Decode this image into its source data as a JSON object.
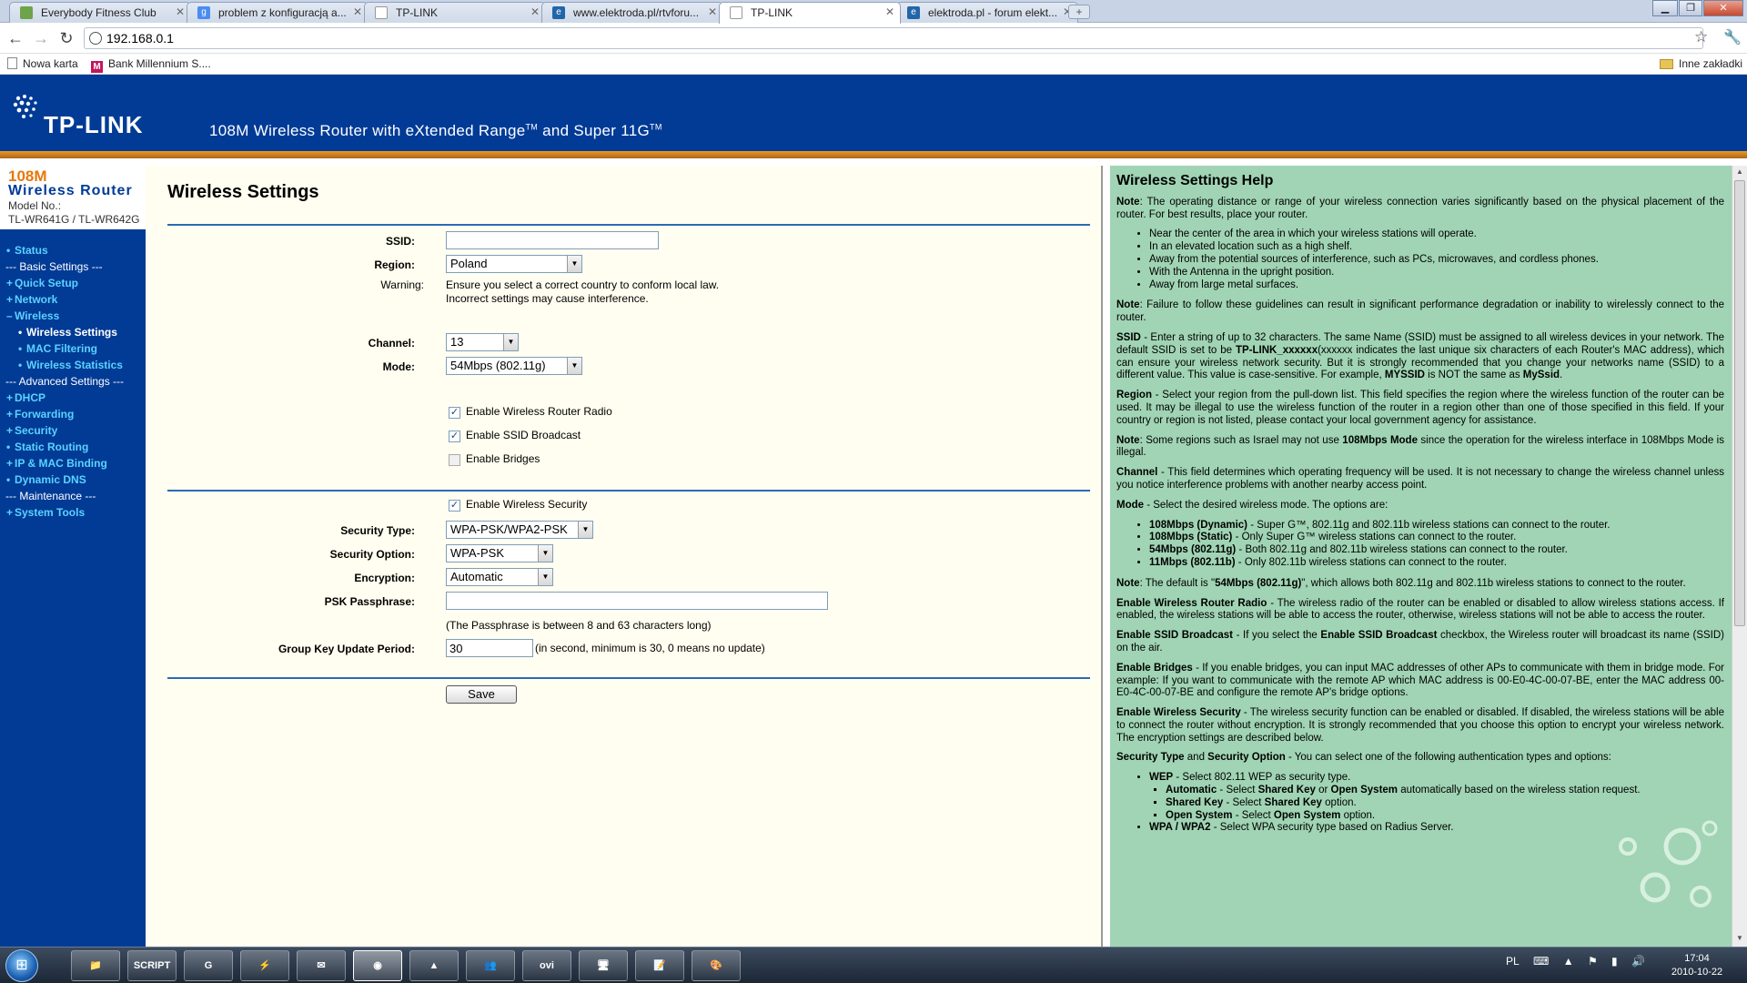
{
  "browser": {
    "tabs": [
      {
        "title": "Everybody Fitness Club",
        "favicon": "page-icon",
        "color": "#e8f0e0"
      },
      {
        "title": "problem z konfiguracją a...",
        "favicon": "google-icon",
        "color": "#4a8cf0"
      },
      {
        "title": "TP-LINK",
        "favicon": "page-icon",
        "color": "#e8e8e8"
      },
      {
        "title": "www.elektroda.pl/rtvforu...",
        "favicon": "elektroda-icon",
        "color": "#2266aa"
      },
      {
        "title": "TP-LINK",
        "favicon": "page-icon",
        "color": "#e8e8e8",
        "active": true
      },
      {
        "title": "elektroda.pl - forum elekt...",
        "favicon": "elektroda-icon",
        "color": "#2266aa"
      }
    ],
    "url": "192.168.0.1",
    "bookmarks": [
      {
        "label": "Nowa karta",
        "icon": "page-icon"
      },
      {
        "label": "Bank Millennium S....",
        "icon": "millennium-icon"
      }
    ],
    "other_bookmarks": "Inne zakładki"
  },
  "router": {
    "logo": "TP-LINK",
    "tagline_prefix": "108M Wireless Router with eXtended Range",
    "tm1": "TM",
    "tagline_mid": " and Super 11G",
    "tm2": "TM",
    "model": {
      "speed": "108M",
      "name": "Wireless  Router",
      "model_label": "Model No.:",
      "model_value": "TL-WR641G / TL-WR642G"
    },
    "menu": [
      {
        "label": "Status",
        "type": "item"
      },
      {
        "label": "--- Basic Settings ---",
        "type": "group"
      },
      {
        "label": "Quick Setup",
        "type": "item"
      },
      {
        "label": "Network",
        "type": "item"
      },
      {
        "label": "Wireless",
        "type": "item-open"
      },
      {
        "label": "Wireless Settings",
        "type": "sub-current"
      },
      {
        "label": "MAC Filtering",
        "type": "sub"
      },
      {
        "label": "Wireless Statistics",
        "type": "sub"
      },
      {
        "label": "--- Advanced Settings ---",
        "type": "group"
      },
      {
        "label": "DHCP",
        "type": "item"
      },
      {
        "label": "Forwarding",
        "type": "item"
      },
      {
        "label": "Security",
        "type": "item"
      },
      {
        "label": "Static Routing",
        "type": "item"
      },
      {
        "label": "IP & MAC Binding",
        "type": "item"
      },
      {
        "label": "Dynamic DNS",
        "type": "item"
      },
      {
        "label": "--- Maintenance ---",
        "type": "group"
      },
      {
        "label": "System Tools",
        "type": "item"
      }
    ]
  },
  "form": {
    "title": "Wireless Settings",
    "ssid_label": "SSID:",
    "ssid_value": "",
    "region_label": "Region:",
    "region_value": "Poland",
    "warning_label": "Warning:",
    "warning_line1": "Ensure you select a correct country to conform local law.",
    "warning_line2": "Incorrect settings may cause interference.",
    "channel_label": "Channel:",
    "channel_value": "13",
    "mode_label": "Mode:",
    "mode_value": "54Mbps (802.11g)",
    "enable_radio": {
      "label": "Enable Wireless Router Radio",
      "checked": true
    },
    "enable_ssid_broadcast": {
      "label": "Enable SSID Broadcast",
      "checked": true
    },
    "enable_bridges": {
      "label": "Enable Bridges",
      "checked": false
    },
    "enable_security": {
      "label": "Enable Wireless Security",
      "checked": true
    },
    "security_type_label": "Security Type:",
    "security_type_value": "WPA-PSK/WPA2-PSK",
    "security_option_label": "Security Option:",
    "security_option_value": "WPA-PSK",
    "encryption_label": "Encryption:",
    "encryption_value": "Automatic",
    "psk_label": "PSK Passphrase:",
    "psk_value": "",
    "psk_hint": "(The Passphrase is between 8 and 63 characters long)",
    "gkup_label": "Group Key Update Period:",
    "gkup_value": "30",
    "gkup_hint": "(in second, minimum is 30, 0 means no update)",
    "save_label": "Save"
  },
  "help": {
    "title": "Wireless Settings Help"
  },
  "taskbar": {
    "apps": [
      "explorer",
      "SCRIPT",
      "G",
      "winamp",
      "office",
      "chrome",
      "network",
      "people",
      "ovi",
      "monitor",
      "notepad",
      "paint"
    ],
    "lang": "PL",
    "time": "17:04",
    "date": "2010-10-22"
  }
}
